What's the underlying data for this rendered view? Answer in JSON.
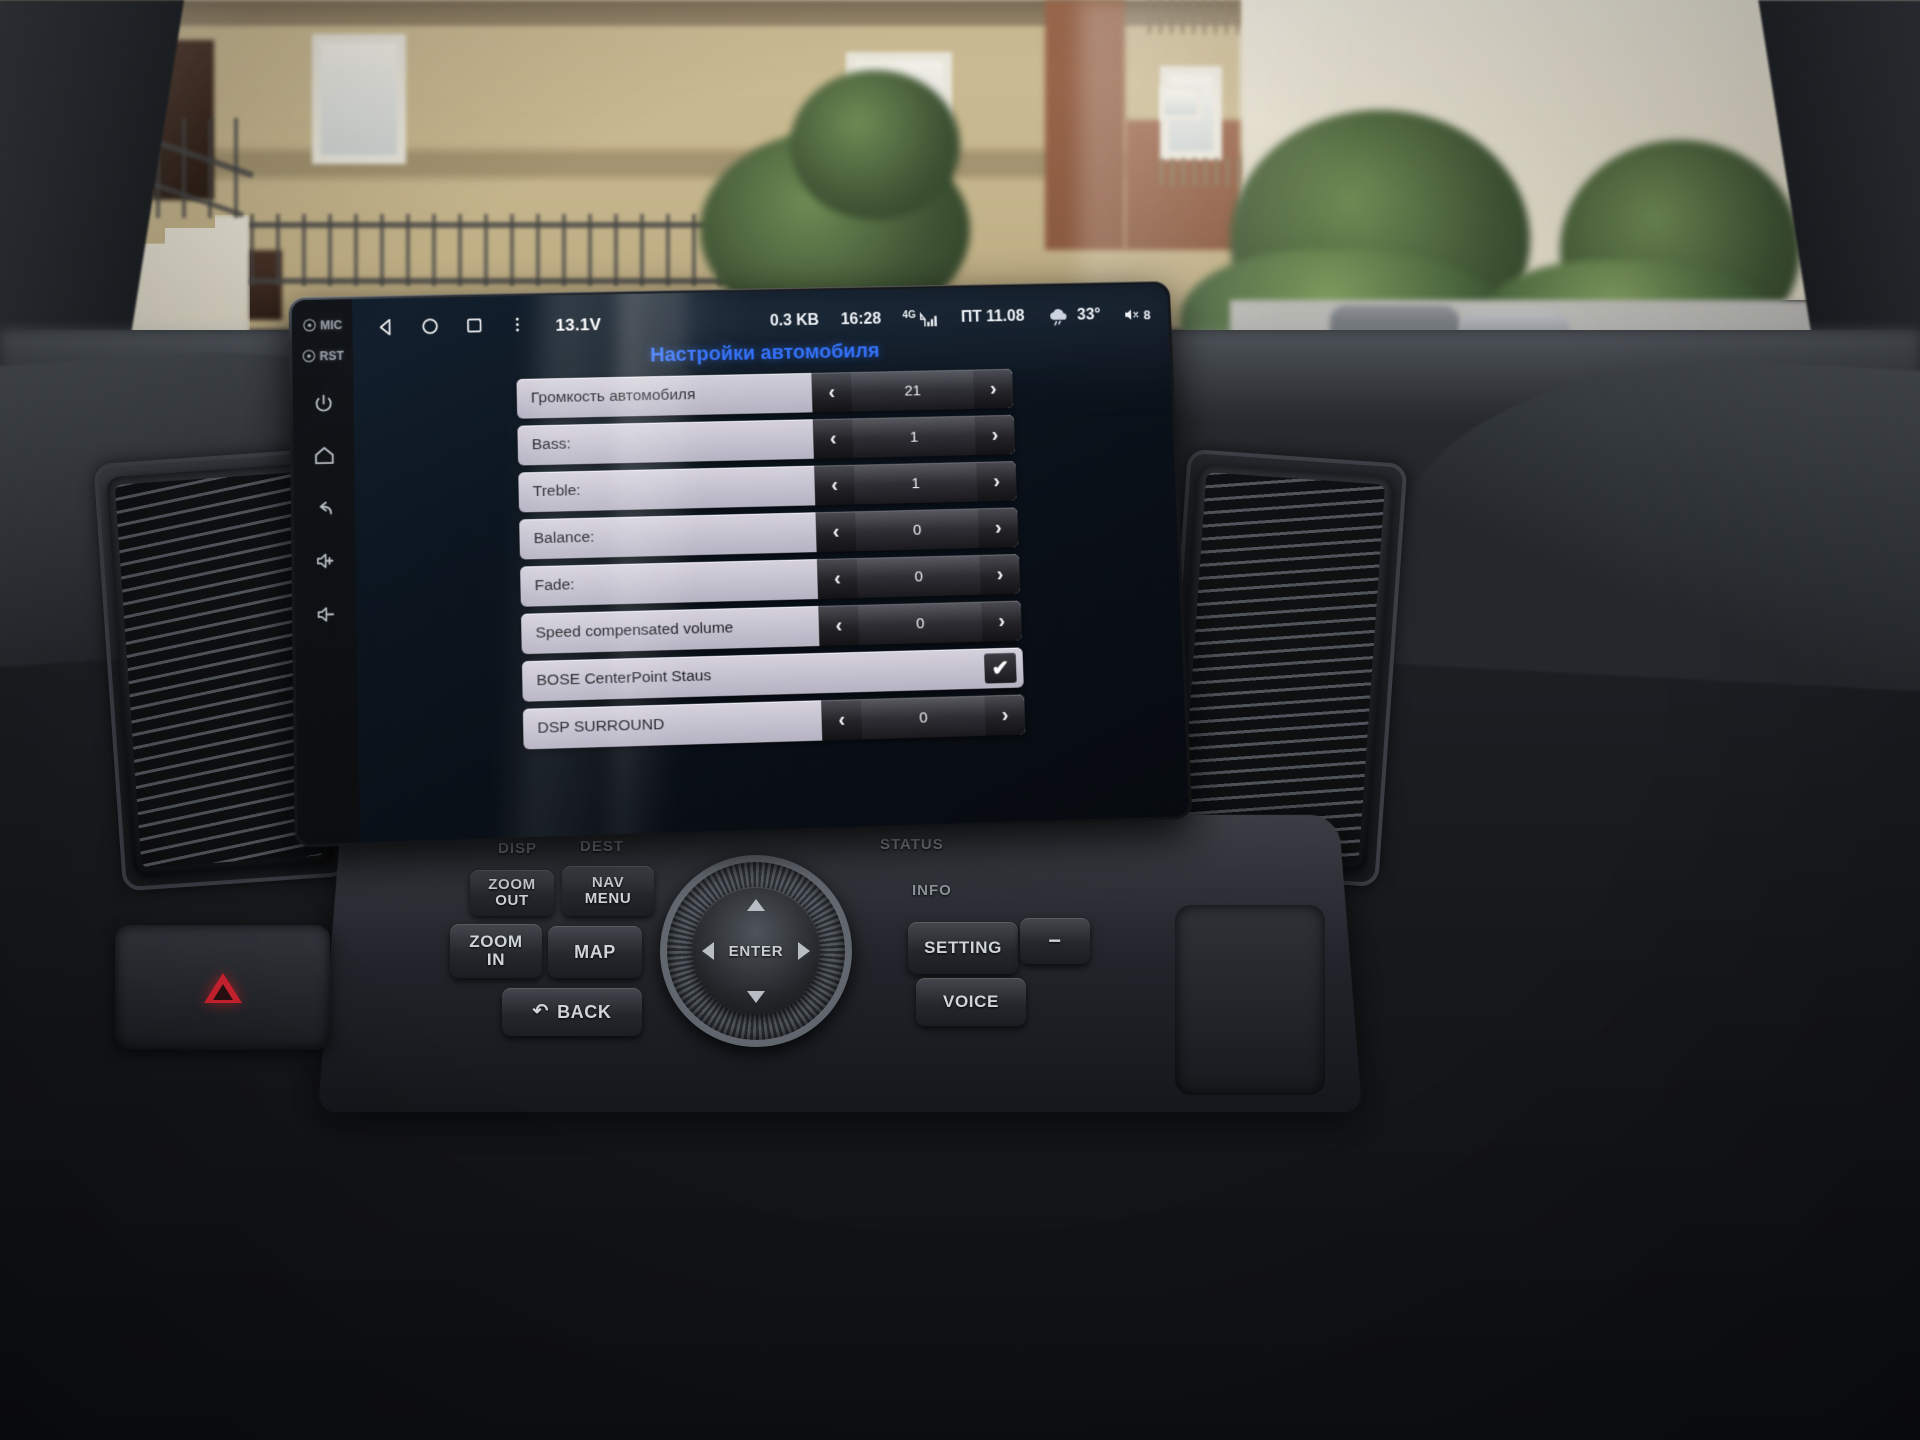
{
  "scene": {
    "description": "car-dashboard-with-android-head-unit"
  },
  "head_unit": {
    "side_buttons": [
      {
        "label": "MIC",
        "icon": "mic-icon"
      },
      {
        "label": "RST",
        "icon": "reset-icon"
      },
      {
        "label": "",
        "icon": "power-icon"
      },
      {
        "label": "",
        "icon": "home-icon"
      },
      {
        "label": "",
        "icon": "back-icon"
      },
      {
        "label": "",
        "icon": "volume-up-icon"
      },
      {
        "label": "",
        "icon": "volume-down-icon"
      }
    ],
    "statusbar": {
      "nav_back": "back-triangle-icon",
      "nav_home": "home-circle-icon",
      "nav_recents": "recents-square-icon",
      "nav_more": "overflow-menu-icon",
      "voltage": "13.1V",
      "data_usage": "0.3 KB",
      "clock": "16:28",
      "network": "4G",
      "signal": "signal-bars-icon",
      "date": "ПТ 11.08",
      "weather_icon": "cloud-rain-icon",
      "temperature": "33°",
      "volume_icon": "volume-mute-icon",
      "volume_value": "8"
    },
    "page_title": "Настройки автомобиля",
    "accent_color": "#2f6fff",
    "settings": [
      {
        "label": "Громкость автомобиля",
        "type": "stepper",
        "value": "21",
        "dec": "‹",
        "inc": "›"
      },
      {
        "label": "Bass:",
        "type": "stepper",
        "value": "1",
        "dec": "‹",
        "inc": "›"
      },
      {
        "label": "Treble:",
        "type": "stepper",
        "value": "1",
        "dec": "‹",
        "inc": "›"
      },
      {
        "label": "Balance:",
        "type": "stepper",
        "value": "0",
        "dec": "‹",
        "inc": "›"
      },
      {
        "label": "Fade:",
        "type": "stepper",
        "value": "0",
        "dec": "‹",
        "inc": "›"
      },
      {
        "label": "Speed compensated volume",
        "type": "stepper",
        "value": "0",
        "dec": "‹",
        "inc": "›"
      },
      {
        "label": "BOSE CenterPoint Staus",
        "type": "checkbox",
        "checked": "✔"
      },
      {
        "label": "DSP SURROUND",
        "type": "stepper",
        "value": "0",
        "dec": "‹",
        "inc": "›"
      }
    ]
  },
  "console": {
    "labels": [
      {
        "text": "DISP"
      },
      {
        "text": "DEST"
      },
      {
        "text": "STATUS"
      },
      {
        "text": "INFO"
      }
    ],
    "buttons": [
      {
        "text": "ZOOM\nOUT"
      },
      {
        "text": "NAV\nMENU"
      },
      {
        "text": "ZOOM\nIN"
      },
      {
        "text": "MAP"
      },
      {
        "text": "SETTING"
      },
      {
        "text": "VOICE"
      },
      {
        "text": "BACK"
      },
      {
        "text": "−"
      }
    ],
    "enter_label": "ENTER",
    "back_label": "BACK",
    "hazard": "hazard-triangle-icon"
  }
}
